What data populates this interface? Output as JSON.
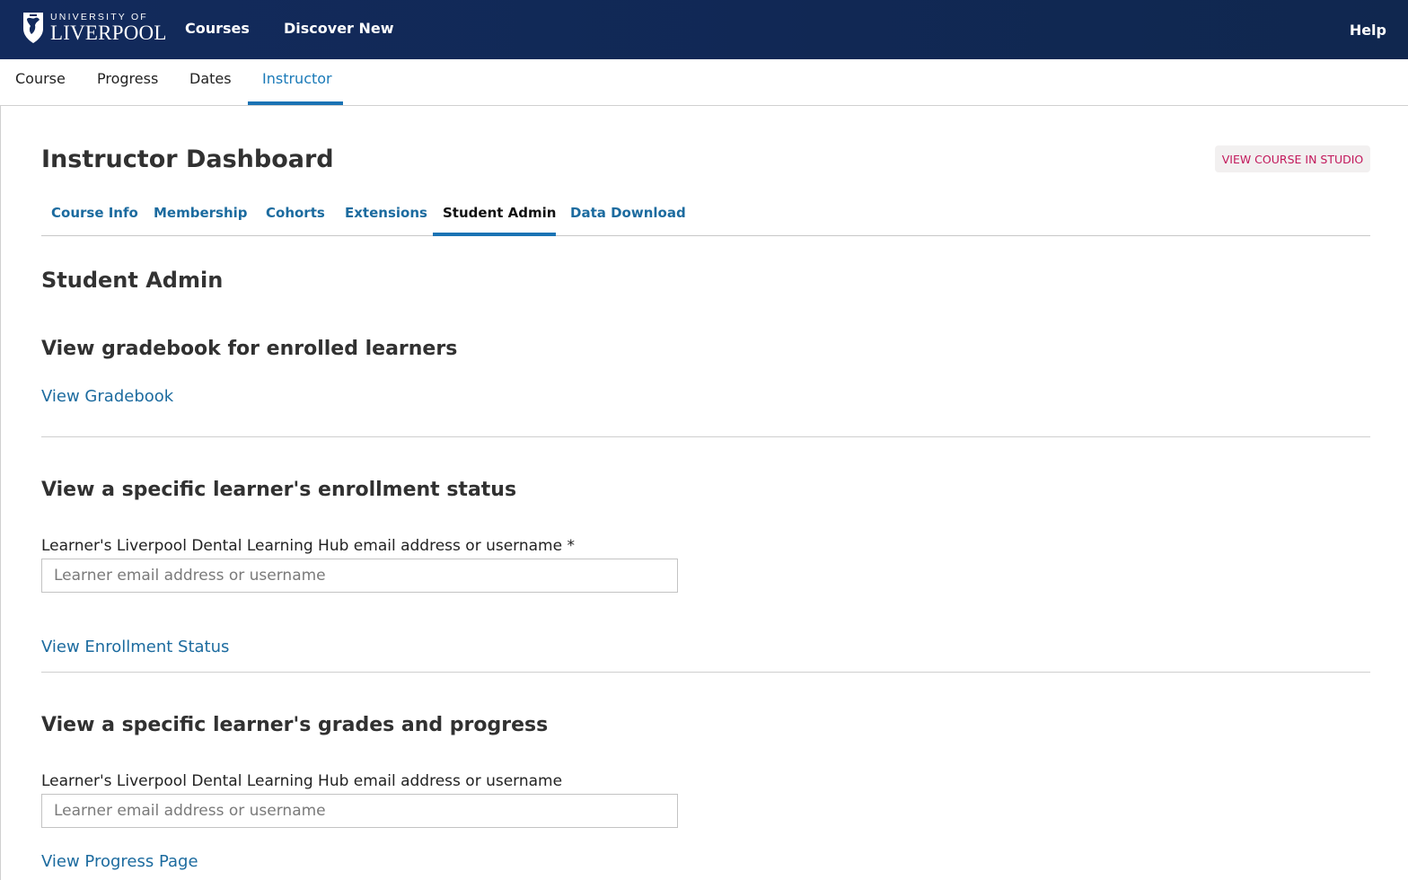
{
  "header": {
    "logo_small": "UNIVERSITY OF",
    "logo_big": "LIVERPOOL",
    "nav": [
      "Courses",
      "Discover New"
    ],
    "help": "Help"
  },
  "course_tabs": [
    "Course",
    "Progress",
    "Dates",
    "Instructor"
  ],
  "dashboard": {
    "title": "Instructor Dashboard",
    "studio_button": "VIEW COURSE IN STUDIO",
    "tabs": [
      "Course Info",
      "Membership",
      "Cohorts",
      "Extensions",
      "Student Admin",
      "Data Download"
    ],
    "active_tab": "Student Admin"
  },
  "student_admin": {
    "title": "Student Admin",
    "gradebook": {
      "heading": "View gradebook for enrolled learners",
      "link": "View Gradebook"
    },
    "enrollment": {
      "heading": "View a specific learner's enrollment status",
      "label": "Learner's Liverpool Dental Learning Hub email address or username *",
      "placeholder": "Learner email address or username",
      "link": "View Enrollment Status"
    },
    "grades": {
      "heading": "View a specific learner's grades and progress",
      "label": "Learner's Liverpool Dental Learning Hub email address or username",
      "placeholder": "Learner email address or username",
      "link": "View Progress Page"
    }
  },
  "colors": {
    "header_bg": "#122a5c",
    "link": "#1c6b9f",
    "active_underline": "#1a73b4",
    "studio_text": "#c2185b"
  }
}
